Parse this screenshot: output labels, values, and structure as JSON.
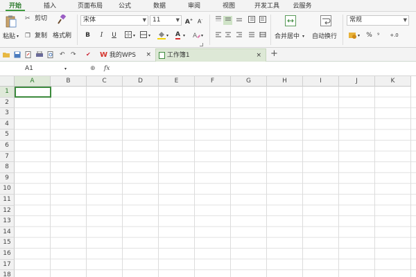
{
  "menu": {
    "tabs": [
      "开始",
      "插入",
      "页面布局",
      "公式",
      "数据",
      "审阅",
      "视图",
      "开发工具",
      "云服务"
    ],
    "active": "开始"
  },
  "ribbon": {
    "paste": "粘贴",
    "cut": "剪切",
    "copy": "复制",
    "format_painter": "格式刷",
    "font_name": "宋体",
    "font_size": "11",
    "bold": "B",
    "italic": "I",
    "underline": "U",
    "font_color": "A",
    "grow_font": "A",
    "shrink_font": "A",
    "merge_center": "合并居中",
    "wrap_text": "自动换行",
    "number_format": "常规",
    "percent": "%"
  },
  "qbar": {
    "tabs": [
      {
        "label": "我的WPS",
        "close": "×"
      },
      {
        "label": "工作簿1",
        "close": "×"
      }
    ],
    "new_tab": "+"
  },
  "formula_bar": {
    "cell_ref": "A1",
    "zoom_icon": "⊕",
    "fx": "fx",
    "value": ""
  },
  "grid": {
    "columns": [
      "A",
      "B",
      "C",
      "D",
      "E",
      "F",
      "G",
      "H",
      "I",
      "J",
      "K"
    ],
    "rows": [
      "1",
      "2",
      "3",
      "4",
      "5",
      "6",
      "7",
      "8",
      "9",
      "10",
      "11",
      "12",
      "13",
      "14",
      "15",
      "16",
      "17",
      "18"
    ],
    "selected_cell": "A1"
  },
  "colors": {
    "accent": "#3c8a3c",
    "wps_logo": "#d6342c"
  }
}
